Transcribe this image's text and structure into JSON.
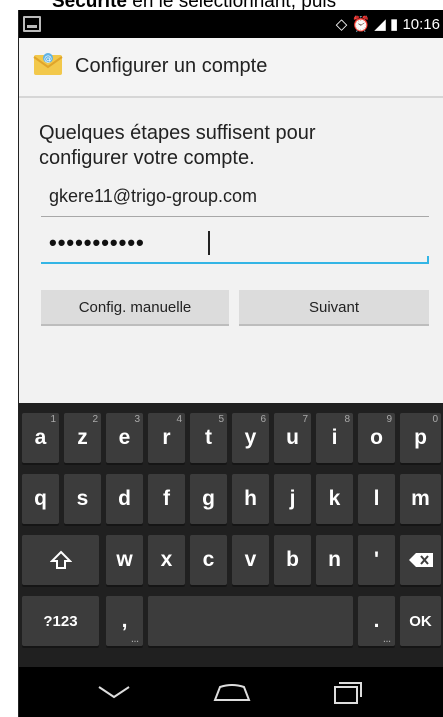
{
  "top_caption": {
    "bold": "Sécurité",
    "rest": " en le sélectionnant, puis"
  },
  "status_bar": {
    "time": "10:16",
    "icons": [
      "nfc-icon",
      "alarm-icon",
      "signal-icon",
      "battery-icon"
    ]
  },
  "app": {
    "title": "Configurer un compte"
  },
  "intro": {
    "line1": "Quelques étapes suffisent pour",
    "line2": "configurer votre compte."
  },
  "form": {
    "email_value": "gkere11@trigo-group.com",
    "password_masked": "•••••••••••"
  },
  "buttons": {
    "manual": "Config. manuelle",
    "next": "Suivant"
  },
  "keyboard": {
    "row1": [
      {
        "label": "a",
        "hint": "1"
      },
      {
        "label": "z",
        "hint": "2"
      },
      {
        "label": "e",
        "hint": "3"
      },
      {
        "label": "r",
        "hint": "4"
      },
      {
        "label": "t",
        "hint": "5"
      },
      {
        "label": "y",
        "hint": "6"
      },
      {
        "label": "u",
        "hint": "7"
      },
      {
        "label": "i",
        "hint": "8"
      },
      {
        "label": "o",
        "hint": "9"
      },
      {
        "label": "p",
        "hint": "0"
      }
    ],
    "row2": [
      "q",
      "s",
      "d",
      "f",
      "g",
      "h",
      "j",
      "k",
      "l",
      "m"
    ],
    "row3": [
      "w",
      "x",
      "c",
      "v",
      "b",
      "n",
      "'"
    ],
    "symbols": "?123",
    "comma": ",",
    "period": ".",
    "ok": "OK"
  }
}
